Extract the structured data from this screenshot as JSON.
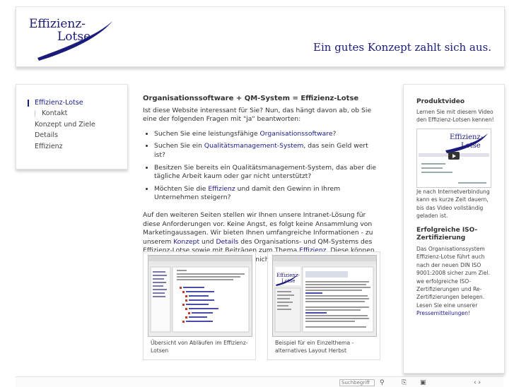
{
  "header": {
    "logo_line1": "Effizienz-",
    "logo_line2": "Lotse",
    "tagline": "Ein gutes Konzept zahlt sich aus."
  },
  "nav": {
    "items": [
      {
        "label": "Effizienz-Lotse",
        "active": true
      },
      {
        "label": "Kontakt",
        "active": false,
        "sub": true
      },
      {
        "label": "Konzept und Ziele",
        "active": false
      },
      {
        "label": "Details",
        "active": false
      },
      {
        "label": "Effizienz",
        "active": false
      }
    ]
  },
  "main": {
    "title": "Organisationssoftware + QM-System = Effizienz-Lotse",
    "intro": "Ist diese Website interessant für Sie? Nun, das hängt davon ab, ob Sie eine der folgenden Fragen mit \"ja\" beantworten:",
    "q1_pre": "Suchen Sie eine leistungsfähige ",
    "q1_link": "Organisationssoftware",
    "q1_post": "?",
    "q2_pre": "Suchen Sie ein ",
    "q2_link": "Qualitätsmanagement-System",
    "q2_post": ", das sein Geld wert ist?",
    "q3": "Besitzen Sie bereits ein Qualitätsmanagement-System, das aber die tägliche Arbeit kaum oder gar nicht unterstützt?",
    "q4_pre": "Möchten Sie die ",
    "q4_link": "Effizienz",
    "q4_post": " und damit den Gewinn in Ihrem Unternehmen steigern?",
    "para_pre": "Auf den weiteren Seiten stellen wir Ihnen unsere Intranet-Lösung für diese Anforderungen vor. Keine Angst, es folgt keine Ansammlung von Marketingaussagen. Wir bieten Ihnen umfangreiche Informationen - zu unserem ",
    "para_link1": "Konzept",
    "para_mid1": " und ",
    "para_link2": "Details",
    "para_mid2": " des Organisations- und QM-Systems des Effizienz-Lotse sowie mit Beiträgen zum Thema ",
    "para_link3": "Effizienz",
    "para_post": ". Diese können Ihnen auch dann helfen, wenn Sie nicht vorhaben, den Effizienz-Lotse an Bord zu holen.",
    "shot1_caption": "Übersicht von Abläufen im Effizienz-Lotsen",
    "shot2_caption": "Beispiel für ein Einzelthema - alternatives Layout Herbst"
  },
  "side": {
    "video_title": "Produktvideo",
    "video_text": "Lernen Sie mit diesem Video den Effizienz-Lotsen kennen!",
    "video_note": "Je nach Internetverbindung kann es kurze Zeit dauern, bis das Video vollständig geladen ist.",
    "iso_title": "Erfolgreiche ISO-Zertifizierung",
    "iso_text": "Das Organisationssystem Effizienz-Lotse führt auch nach der neuen DIN ISO 9001:2008 sicher zum Ziel. we erfolgreiche ISO-Zertifizierungen und Re-Zertifizierungen belegen. Lesen Sie eine unserer ",
    "iso_link": "Pressemitteilungen",
    "iso_end": "!"
  },
  "footer": {
    "search_placeholder": "Suchbegriff"
  },
  "colors": {
    "accent": "#1a1a8c",
    "nav_bar": "#1b1b7a"
  }
}
